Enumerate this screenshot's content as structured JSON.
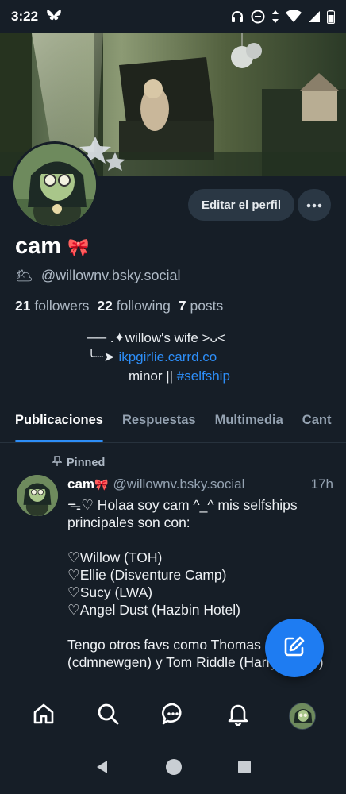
{
  "status_bar": {
    "time": "3:22"
  },
  "profile": {
    "display_name": "cam",
    "name_emoji": "🎀",
    "status_emoji": "🌥",
    "handle": "@willownv.bsky.social",
    "edit_label": "Editar el perfil",
    "followers_count": "21",
    "followers_label": "followers",
    "following_count": "22",
    "following_label": "following",
    "posts_count": "7",
    "posts_label": "posts",
    "bio": {
      "line1": "── .✦willow's wife >ᴗ<",
      "line2_prefix": "╰┈➤ ",
      "line2_link": "ikpgirlie.carrd.co",
      "line3_prefix": "minor || ",
      "line3_link": "#selfship"
    }
  },
  "tabs": [
    {
      "label": "Publicaciones",
      "active": true
    },
    {
      "label": "Respuestas",
      "active": false
    },
    {
      "label": "Multimedia",
      "active": false
    },
    {
      "label": "Cant",
      "active": false
    }
  ],
  "post": {
    "pinned_label": "Pinned",
    "author_name": "cam",
    "author_emoji": "🎀",
    "author_handle": "@willownv.bsky.social",
    "time": "17h",
    "body": "ᯓ♡ Holaa soy cam ^_^ mis selfships principales son con:\n\n♡Willow (TOH)\n♡Ellie (Disventure Camp)\n♡Sucy (LWA)\n♡Angel Dust (Hazbin Hotel)\n\nTengo otros favs como Thomas (cdmnewgen) y Tom Riddle (Harry Potter)"
  },
  "bottom_nav": [
    "home-icon",
    "search-icon",
    "chat-icon",
    "bell-icon",
    "profile-avatar"
  ],
  "colors": {
    "background": "#161e27",
    "accent": "#2d8ef8",
    "fab": "#1e7cf2"
  }
}
